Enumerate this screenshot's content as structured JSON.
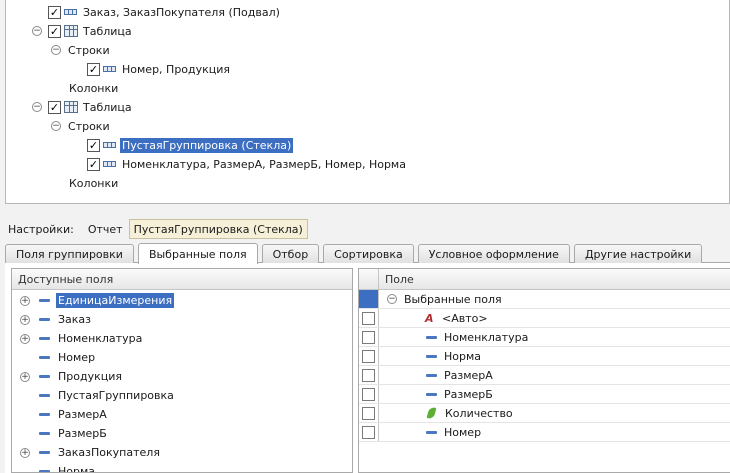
{
  "structure_tree": {
    "items": [
      {
        "label": "Заказ, ЗаказПокупателя (Подвал)"
      },
      {
        "label": "Таблица"
      },
      {
        "label": "Строки"
      },
      {
        "label": "Номер, Продукция"
      },
      {
        "label": "Колонки"
      },
      {
        "label": "Таблица"
      },
      {
        "label": "Строки"
      },
      {
        "label": "ПустаяГруппировка (Стекла)"
      },
      {
        "label": "Номенклатура, РазмерА, РазмерБ, Номер, Норма"
      },
      {
        "label": "Колонки"
      }
    ]
  },
  "settings": {
    "label": "Настройки:",
    "report_label": "Отчет",
    "report_value": "ПустаяГруппировка (Стекла)"
  },
  "tabs": [
    {
      "label": "Поля группировки"
    },
    {
      "label": "Выбранные поля",
      "active": true
    },
    {
      "label": "Отбор"
    },
    {
      "label": "Сортировка"
    },
    {
      "label": "Условное оформление"
    },
    {
      "label": "Другие настройки"
    }
  ],
  "available_fields": {
    "header": "Доступные поля",
    "items": [
      {
        "label": "ЕдиницаИзмерения",
        "expandable": true,
        "selected": true
      },
      {
        "label": "Заказ",
        "expandable": true
      },
      {
        "label": "Номенклатура",
        "expandable": true
      },
      {
        "label": "Номер",
        "expandable": false
      },
      {
        "label": "Продукция",
        "expandable": true
      },
      {
        "label": "ПустаяГруппировка",
        "expandable": false
      },
      {
        "label": "РазмерА",
        "expandable": false
      },
      {
        "label": "РазмерБ",
        "expandable": false
      },
      {
        "label": "ЗаказПокупателя",
        "expandable": true
      },
      {
        "label": "Норма",
        "expandable": false
      }
    ]
  },
  "selected_fields": {
    "header": "Поле",
    "group_label": "Выбранные поля",
    "items": [
      {
        "label": "<Авто>",
        "icon": "auto-icon"
      },
      {
        "label": "Номенклатура",
        "icon": "field-icon"
      },
      {
        "label": "Норма",
        "icon": "field-icon"
      },
      {
        "label": "РазмерА",
        "icon": "field-icon"
      },
      {
        "label": "РазмерБ",
        "icon": "field-icon"
      },
      {
        "label": "Количество",
        "icon": "resource-icon"
      },
      {
        "label": "Номер",
        "icon": "field-icon"
      }
    ]
  },
  "colors": {
    "selection": "#3c6ec2",
    "resource": "#5db034"
  }
}
